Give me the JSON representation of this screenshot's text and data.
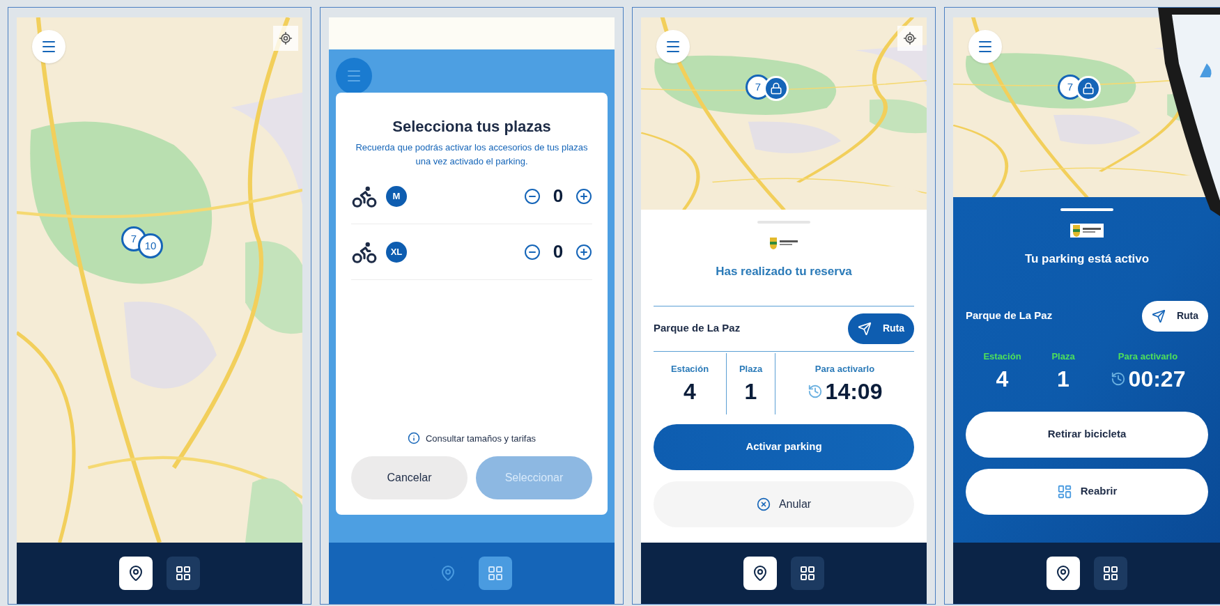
{
  "panels": [
    {
      "kind": "map",
      "markers": [
        {
          "kind": "count",
          "label": "7"
        },
        {
          "kind": "count",
          "label": "10"
        }
      ],
      "locate_button": true,
      "nav": [
        {
          "kind": "pin",
          "selected": true
        },
        {
          "kind": "grid",
          "selected": false
        }
      ]
    },
    {
      "kind": "select",
      "title": "Selecciona tus plazas",
      "subtitle": "Recuerda que podrás activar los accesorios de tus plazas una vez activado el parking.",
      "rows": [
        {
          "size": "M",
          "count": "0"
        },
        {
          "size": "XL",
          "count": "0"
        }
      ],
      "info": "Consultar tamaños y tarifas",
      "cancel": "Cancelar",
      "confirm": "Seleccionar",
      "confirm_disabled": true,
      "nav": [
        {
          "kind": "pin",
          "selected": false
        },
        {
          "kind": "grid",
          "selected": true
        }
      ]
    },
    {
      "kind": "reservation",
      "markers": [
        {
          "kind": "count",
          "label": "7"
        },
        {
          "kind": "lock"
        }
      ],
      "locate_button": true,
      "title": "Has realizado tu reserva",
      "place": "Parque de La Paz",
      "route": "Ruta",
      "stats": [
        {
          "label": "Estación",
          "value": "4",
          "timer": false
        },
        {
          "label": "Plaza",
          "value": "1",
          "timer": false
        },
        {
          "label": "Para activarlo",
          "value": "14:09",
          "timer": true
        }
      ],
      "actions": [
        {
          "kind": "primary",
          "label": "Activar parking"
        },
        {
          "kind": "cancel",
          "label": "Anular"
        }
      ],
      "nav": [
        {
          "kind": "pin",
          "selected": true
        },
        {
          "kind": "grid",
          "selected": false
        }
      ]
    },
    {
      "kind": "active",
      "markers": [
        {
          "kind": "count",
          "label": "7"
        },
        {
          "kind": "lock"
        }
      ],
      "title": "Tu parking está activo",
      "place": "Parque de La Paz",
      "route": "Ruta",
      "stats": [
        {
          "label": "Estación",
          "value": "4",
          "timer": false
        },
        {
          "label": "Plaza",
          "value": "1",
          "timer": false
        },
        {
          "label": "Para activarlo",
          "value": "00:27",
          "timer": true
        }
      ],
      "actions": [
        {
          "kind": "light",
          "label": "Retirar bicicleta"
        },
        {
          "kind": "reopen",
          "label": "Reabrir"
        }
      ],
      "nav": [
        {
          "kind": "pin",
          "selected": true
        },
        {
          "kind": "grid",
          "selected": false
        }
      ]
    }
  ]
}
